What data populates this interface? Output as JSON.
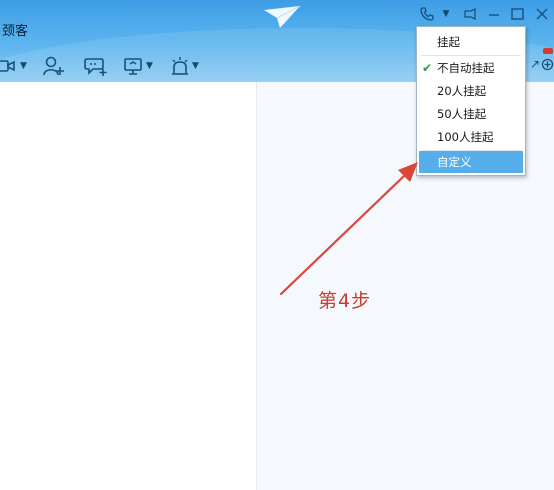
{
  "window": {
    "title": "颈客"
  },
  "menu": {
    "items": [
      {
        "label": "挂起",
        "checked": false
      },
      {
        "label": "不自动挂起",
        "checked": true
      },
      {
        "label": "20人挂起",
        "checked": false
      },
      {
        "label": "50人挂起",
        "checked": false
      },
      {
        "label": "100人挂起",
        "checked": false
      },
      {
        "label": "自定义",
        "checked": false,
        "highlighted": true
      }
    ],
    "check_glyph": "✔"
  },
  "annotation": {
    "step_label": "第4步",
    "color": "#cc3b2f"
  },
  "colors": {
    "header": "#4aa7ea",
    "menu_highlight": "#55aeea",
    "check": "#2e9c38"
  }
}
